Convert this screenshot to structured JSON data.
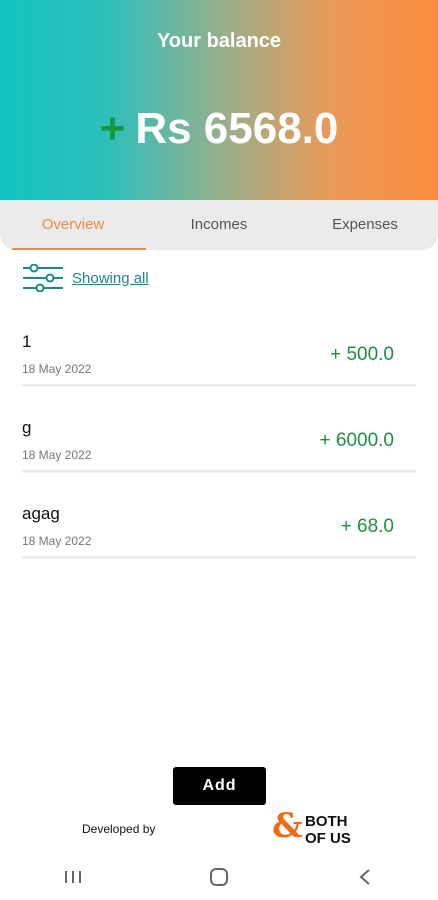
{
  "header": {
    "title": "Your balance",
    "sign": "+",
    "amount": "Rs 6568.0"
  },
  "tabs": [
    {
      "label": "Overview",
      "active": true
    },
    {
      "label": "Incomes",
      "active": false
    },
    {
      "label": "Expenses",
      "active": false
    }
  ],
  "filter": {
    "icon": "filter-sliders-icon",
    "label": "Showing all"
  },
  "transactions": [
    {
      "title": "1",
      "date": "18 May 2022",
      "amount": "+ 500.0"
    },
    {
      "title": "g",
      "date": "18 May 2022",
      "amount": "+ 6000.0"
    },
    {
      "title": "agag",
      "date": "18 May 2022",
      "amount": "+ 68.0"
    }
  ],
  "actions": {
    "add_label": "Add"
  },
  "footer": {
    "developed_by": "Developed by",
    "logo_amp": "&",
    "logo_line1": "BOTH",
    "logo_line2": "OF US"
  },
  "colors": {
    "accent": "#f08a3c",
    "income": "#1f8f3f",
    "gradient_start": "#12c2c0",
    "gradient_end": "#fb8d3f"
  },
  "system_nav": [
    "recent-apps-icon",
    "home-icon",
    "back-icon"
  ]
}
